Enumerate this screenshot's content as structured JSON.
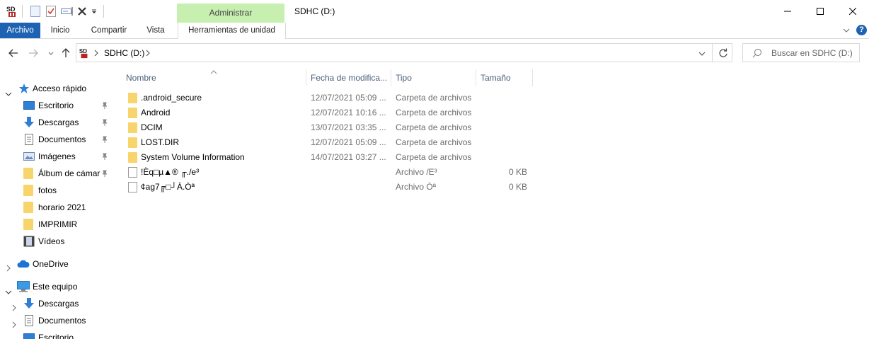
{
  "window": {
    "title": "SDHC (D:)",
    "contextual_tab": "Administrar",
    "controls": [
      "minimize-icon",
      "maximize-icon",
      "close-icon"
    ]
  },
  "quick_access_toolbar": [
    "sd-drive-icon",
    "properties-icon",
    "check-icon",
    "rename-icon",
    "delete-icon",
    "dropdown-icon"
  ],
  "ribbon": {
    "tabs": [
      "Archivo",
      "Inicio",
      "Compartir",
      "Vista",
      "Herramientas de unidad"
    ]
  },
  "address_bar": {
    "path_root_icon": "sd-drive-icon",
    "path": "SDHC (D:)"
  },
  "search": {
    "placeholder": "Buscar en SDHC (D:)"
  },
  "nav_pane": {
    "quick_access": {
      "label": "Acceso rápido",
      "items": [
        {
          "label": "Escritorio",
          "icon": "desktop-icon",
          "pinned": true
        },
        {
          "label": "Descargas",
          "icon": "download-icon",
          "pinned": true
        },
        {
          "label": "Documentos",
          "icon": "documents-icon",
          "pinned": true
        },
        {
          "label": "Imágenes",
          "icon": "pictures-icon",
          "pinned": true
        },
        {
          "label": "Álbum de cámar",
          "icon": "folder-icon",
          "pinned": true
        },
        {
          "label": "fotos",
          "icon": "folder-icon",
          "pinned": false
        },
        {
          "label": "horario 2021",
          "icon": "folder-icon",
          "pinned": false
        },
        {
          "label": "IMPRIMIR",
          "icon": "folder-icon",
          "pinned": false
        },
        {
          "label": "Vídeos",
          "icon": "videos-icon",
          "pinned": false
        }
      ]
    },
    "onedrive": {
      "label": "OneDrive"
    },
    "this_pc": {
      "label": "Este equipo",
      "items": [
        {
          "label": "Descargas",
          "icon": "download-icon"
        },
        {
          "label": "Documentos",
          "icon": "documents-icon"
        },
        {
          "label": "Escritorio",
          "icon": "desktop-icon"
        }
      ]
    }
  },
  "file_list": {
    "columns": [
      "Nombre",
      "Fecha de modifica...",
      "Tipo",
      "Tamaño"
    ],
    "rows": [
      {
        "name": ".android_secure",
        "date": "12/07/2021 05:09 ...",
        "type": "Carpeta de archivos",
        "size": "",
        "kind": "folder"
      },
      {
        "name": "Android",
        "date": "12/07/2021 10:16 ...",
        "type": "Carpeta de archivos",
        "size": "",
        "kind": "folder"
      },
      {
        "name": "DCIM",
        "date": "13/07/2021 03:35 ...",
        "type": "Carpeta de archivos",
        "size": "",
        "kind": "folder"
      },
      {
        "name": "LOST.DIR",
        "date": "12/07/2021 05:09 ...",
        "type": "Carpeta de archivos",
        "size": "",
        "kind": "folder"
      },
      {
        "name": "System Volume Information",
        "date": "14/07/2021 03:27 ...",
        "type": "Carpeta de archivos",
        "size": "",
        "kind": "folder"
      },
      {
        "name": "!Èq□µ▲® ╓./e³",
        "date": "",
        "type": "Archivo /E³",
        "size": "0 KB",
        "kind": "file"
      },
      {
        "name": "¢ag7╔□┘À.Òª",
        "date": "",
        "type": "Archivo Òª",
        "size": "0 KB",
        "kind": "file"
      }
    ]
  }
}
